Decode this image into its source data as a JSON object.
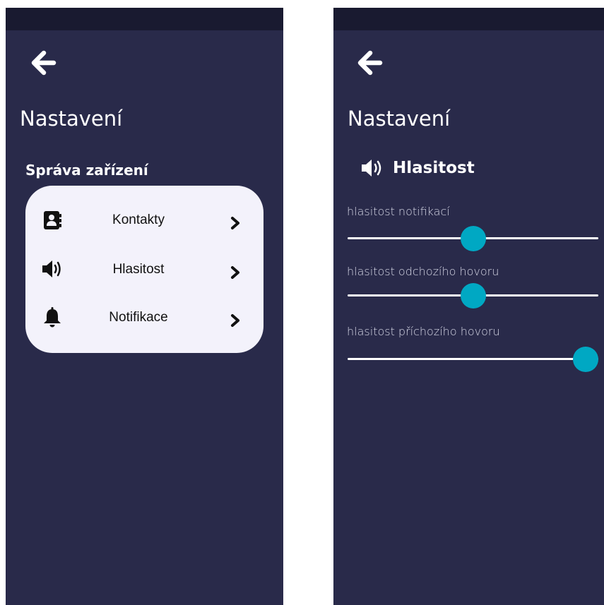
{
  "colors": {
    "background": "#292a4a",
    "status_bar": "#191a30",
    "card": "#f3f2fb",
    "accent": "#00a8c3",
    "text_light": "#ffffff",
    "text_dark": "#111111"
  },
  "left_screen": {
    "back_icon": "arrow-left-icon",
    "title": "Nastavení",
    "section_title": "Správa zařízení",
    "items": [
      {
        "label": "Kontakty",
        "icon": "address-book-icon"
      },
      {
        "label": "Hlasitost",
        "icon": "volume-icon"
      },
      {
        "label": "Notifikace",
        "icon": "bell-icon"
      }
    ]
  },
  "right_screen": {
    "back_icon": "arrow-left-icon",
    "title": "Nastavení",
    "section_title": "Hlasitost",
    "section_icon": "volume-icon",
    "sliders": [
      {
        "label": "hlasitost notifikací",
        "value": 0.5
      },
      {
        "label": "hlasitost odchozího hovoru",
        "value": 0.5
      },
      {
        "label": "hlasitost příchozího hovoru",
        "value": 0.95
      }
    ]
  }
}
